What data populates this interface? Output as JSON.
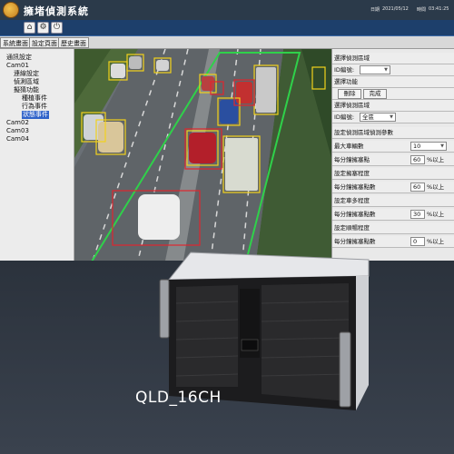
{
  "app": {
    "title": "擁堵偵測系統",
    "date_label": "日期",
    "date": "2021/05/12",
    "time_label": "時間",
    "time": "03:41:25"
  },
  "toolbar": {
    "icons": [
      "home-icon",
      "gear-icon",
      "power-icon"
    ]
  },
  "tabs": [
    "系統畫面",
    "設定頁面",
    "歷史畫面"
  ],
  "tree": {
    "items": [
      {
        "label": "通訊設定",
        "selected": false
      },
      {
        "label": "Cam01",
        "selected": false
      },
      {
        "label": "連線設定",
        "selected": false
      },
      {
        "label": "偵測區域",
        "selected": false
      },
      {
        "label": "擬猜功能",
        "selected": false
      },
      {
        "label": "種植事件",
        "selected": false
      },
      {
        "label": "行為事件",
        "selected": false
      },
      {
        "label": "狀態事件",
        "selected": true
      },
      {
        "label": "Cam02",
        "selected": false
      },
      {
        "label": "Cam03",
        "selected": false
      },
      {
        "label": "Cam04",
        "selected": false
      }
    ]
  },
  "panel": {
    "select_area_title": "選擇偵測區域",
    "id_label_1": "ID編號:",
    "id_value_1": "",
    "select_function_title": "選擇功能",
    "delete_button": "刪除",
    "done_button": "完成",
    "select_detect_area_title": "選擇偵測區域",
    "id_label_2": "ID編號:",
    "id_value_2": "全區",
    "params_title": "設定偵測區域偵測參數",
    "max_vehicles_label": "最大車輛數",
    "max_vehicles_value": "10",
    "congestion_pct_label_1": "每分鐘擁塞點",
    "congestion_pct_value_1": "60",
    "unit_pct_1": "%以上",
    "degree_label_1": "設定擁塞程度",
    "congestion_pct_label_2": "每分鐘擁塞點數",
    "congestion_pct_value_2": "60",
    "unit_pct_2": "%以上",
    "degree_label_2": "設定車多程度",
    "congestion_pct_label_3": "每分鐘擁塞點數",
    "congestion_pct_value_3": "30",
    "unit_pct_3": "%以上",
    "degree_label_3": "設定順暢程度",
    "congestion_pct_label_4": "每分鐘擁塞點數",
    "congestion_pct_value_4": "0",
    "unit_pct_4": "%以上"
  },
  "product": {
    "model": "QLD_16CH"
  },
  "colors": {
    "title_bar": "#2b3a4a",
    "icon_bar": "#1d3f6b",
    "detect_yellow": "#f2d21b",
    "detect_red": "#e0262e",
    "zone_green": "#2fd14a"
  }
}
